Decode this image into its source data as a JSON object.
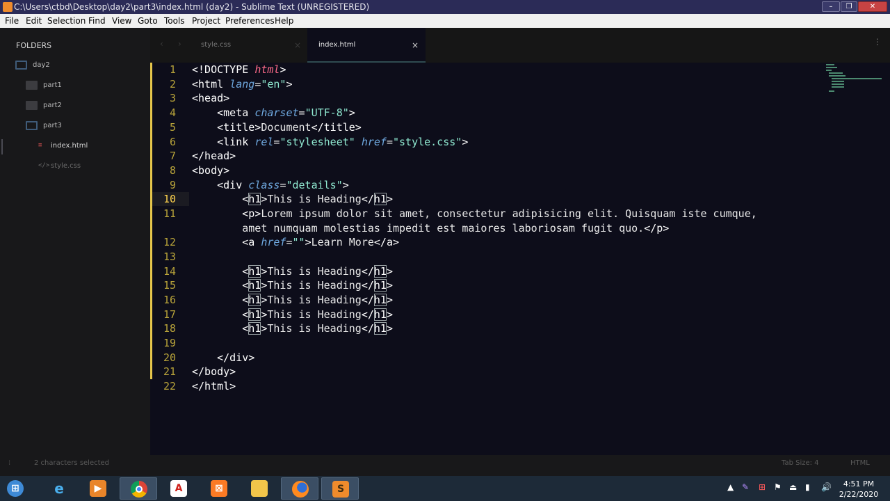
{
  "window": {
    "title": "C:\\Users\\ctbd\\Desktop\\day2\\part3\\index.html (day2) - Sublime Text (UNREGISTERED)",
    "controls": [
      "minimize",
      "restore",
      "close"
    ]
  },
  "menu": [
    "File",
    "Edit",
    "Selection",
    "Find",
    "View",
    "Goto",
    "Tools",
    "Project",
    "Preferences",
    "Help"
  ],
  "sidebar": {
    "heading": "FOLDERS",
    "items": [
      {
        "label": "day2",
        "type": "folder-open"
      },
      {
        "label": "part1",
        "type": "folder"
      },
      {
        "label": "part2",
        "type": "folder"
      },
      {
        "label": "part3",
        "type": "folder-open"
      },
      {
        "label": "index.html",
        "type": "file-html",
        "icon": "≡"
      },
      {
        "label": "style.css",
        "type": "file-css",
        "icon": "</>"
      }
    ]
  },
  "tabs": [
    {
      "label": "style.css",
      "close": "×",
      "active": false
    },
    {
      "label": "index.html",
      "close": "×",
      "active": true
    }
  ],
  "editor": {
    "line_numbers": [
      "1",
      "2",
      "3",
      "4",
      "5",
      "6",
      "7",
      "8",
      "9",
      "10",
      "11",
      "",
      "12",
      "13",
      "14",
      "15",
      "16",
      "17",
      "18",
      "19",
      "20",
      "21",
      "22"
    ],
    "current_line": "10"
  },
  "status": {
    "left": "2 characters selected",
    "tab_size": "Tab Size: 4",
    "syntax": "HTML"
  },
  "taskbar": {
    "apps": [
      "start",
      "internet-explorer",
      "media-player",
      "chrome",
      "adobe-reader",
      "xampp",
      "file-explorer",
      "firefox",
      "sublime-text"
    ],
    "time": "4:51 PM",
    "date": "2/22/2020"
  },
  "colors": {
    "editor_bg": "#0d0d1a",
    "tag": "#ffffff",
    "attribute": "#6fa9e0",
    "string": "#8fe8d0",
    "doctype": "#ff6b8a",
    "line_number": "#b8a33a",
    "modified_marker": "#e5c64b"
  }
}
